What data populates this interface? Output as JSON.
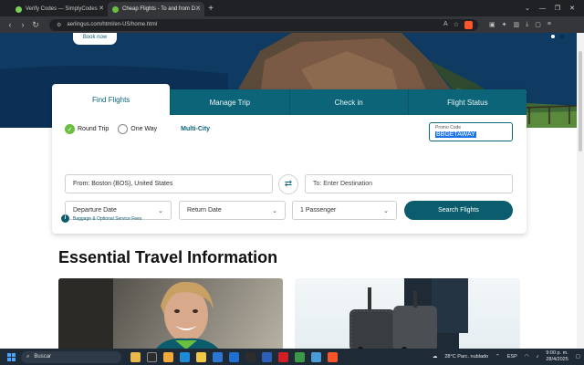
{
  "browser": {
    "tabs": [
      {
        "title": "Verify Codes — SimplyCodes",
        "active": false,
        "favicon_color": "#7bd15a"
      },
      {
        "title": "Cheap Flights - To and from D…",
        "active": true,
        "favicon_color": "#6bbf3f"
      }
    ],
    "new_tab_label": "+",
    "url": "aerlingus.com/html/en-US/home.html"
  },
  "hero": {
    "book_now_label": "Book now"
  },
  "widget": {
    "tabs": [
      "Find Flights",
      "Manage Trip",
      "Check in",
      "Flight Status"
    ],
    "trip_types": {
      "round_trip": "Round Trip",
      "one_way": "One Way",
      "multi_city": "Multi-City"
    },
    "promo": {
      "label": "Promo Code",
      "value": "BBGETAWAY"
    },
    "from_value": "From: Boston (BOS), United States",
    "to_placeholder": "To: Enter Destination",
    "departure_label": "Departure Date",
    "return_label": "Return Date",
    "passengers_value": "1 Passenger",
    "search_label": "Search Flights"
  },
  "info_link": "Baggage & Optional Service Fees",
  "section_title": "Essential Travel Information",
  "taskbar": {
    "search_label": "Buscar",
    "weather": "28°C  Parc. nublado",
    "language": "ESP",
    "time": "9:00 p. m.",
    "date": "28/4/2025"
  },
  "colors": {
    "brand_teal": "#0b6478",
    "accent_green": "#6bbf3f"
  }
}
